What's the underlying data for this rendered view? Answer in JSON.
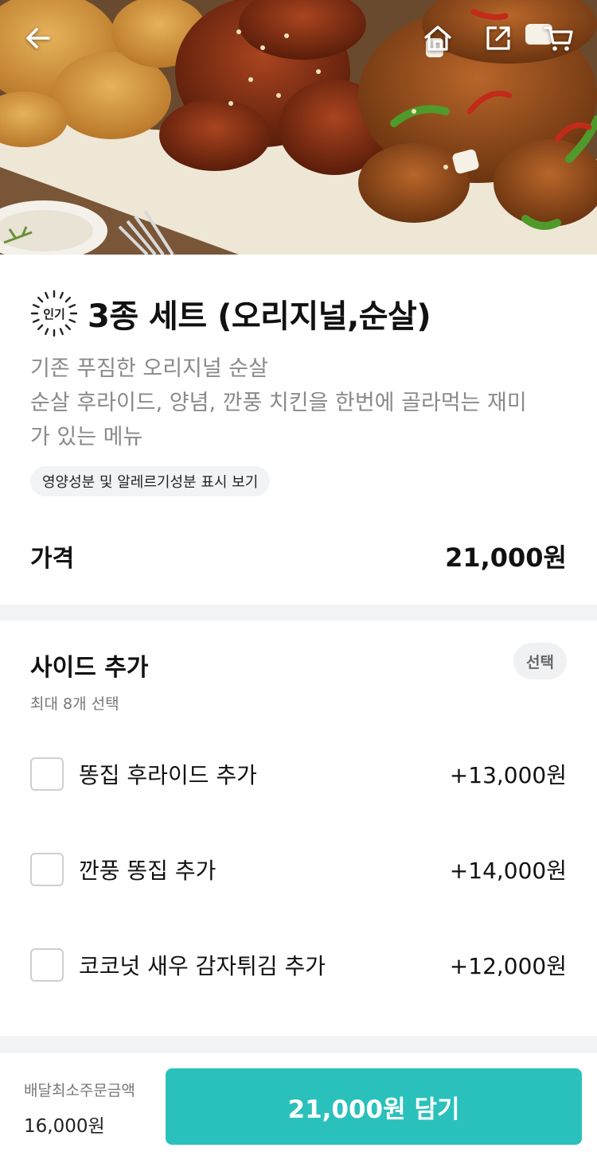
{
  "header": {
    "back_icon": "arrow-left-icon",
    "home_icon": "home-icon",
    "share_icon": "share-icon",
    "cart_icon": "cart-icon"
  },
  "product": {
    "badge": "인기",
    "title": "3종 세트 (오리지널,순살)",
    "description_lines": [
      "기존 푸짐한 오리지널 순살",
      "순살 후라이드, 양념, 깐풍 치킨을 한번에 골라먹는 재미",
      "가 있는 메뉴"
    ],
    "nutrition_link": "영양성분 및 알레르기성분 표시 보기",
    "price_label": "가격",
    "price_value": "21,000원"
  },
  "side": {
    "title": "사이드 추가",
    "subtitle": "최대 8개 선택",
    "tag": "선택",
    "options": [
      {
        "label": "똥집 후라이드 추가",
        "price": "+13,000원",
        "checked": false
      },
      {
        "label": "깐풍 똥집 추가",
        "price": "+14,000원",
        "checked": false
      },
      {
        "label": "코코넛 새우 감자튀김 추가",
        "price": "+12,000원",
        "checked": false
      }
    ]
  },
  "bottom": {
    "min_order_label": "배달최소주문금액",
    "min_order_value": "16,000원",
    "cart_button": "21,000원 담기"
  },
  "colors": {
    "accent": "#2ac1bc",
    "divider": "#f2f3f5"
  }
}
